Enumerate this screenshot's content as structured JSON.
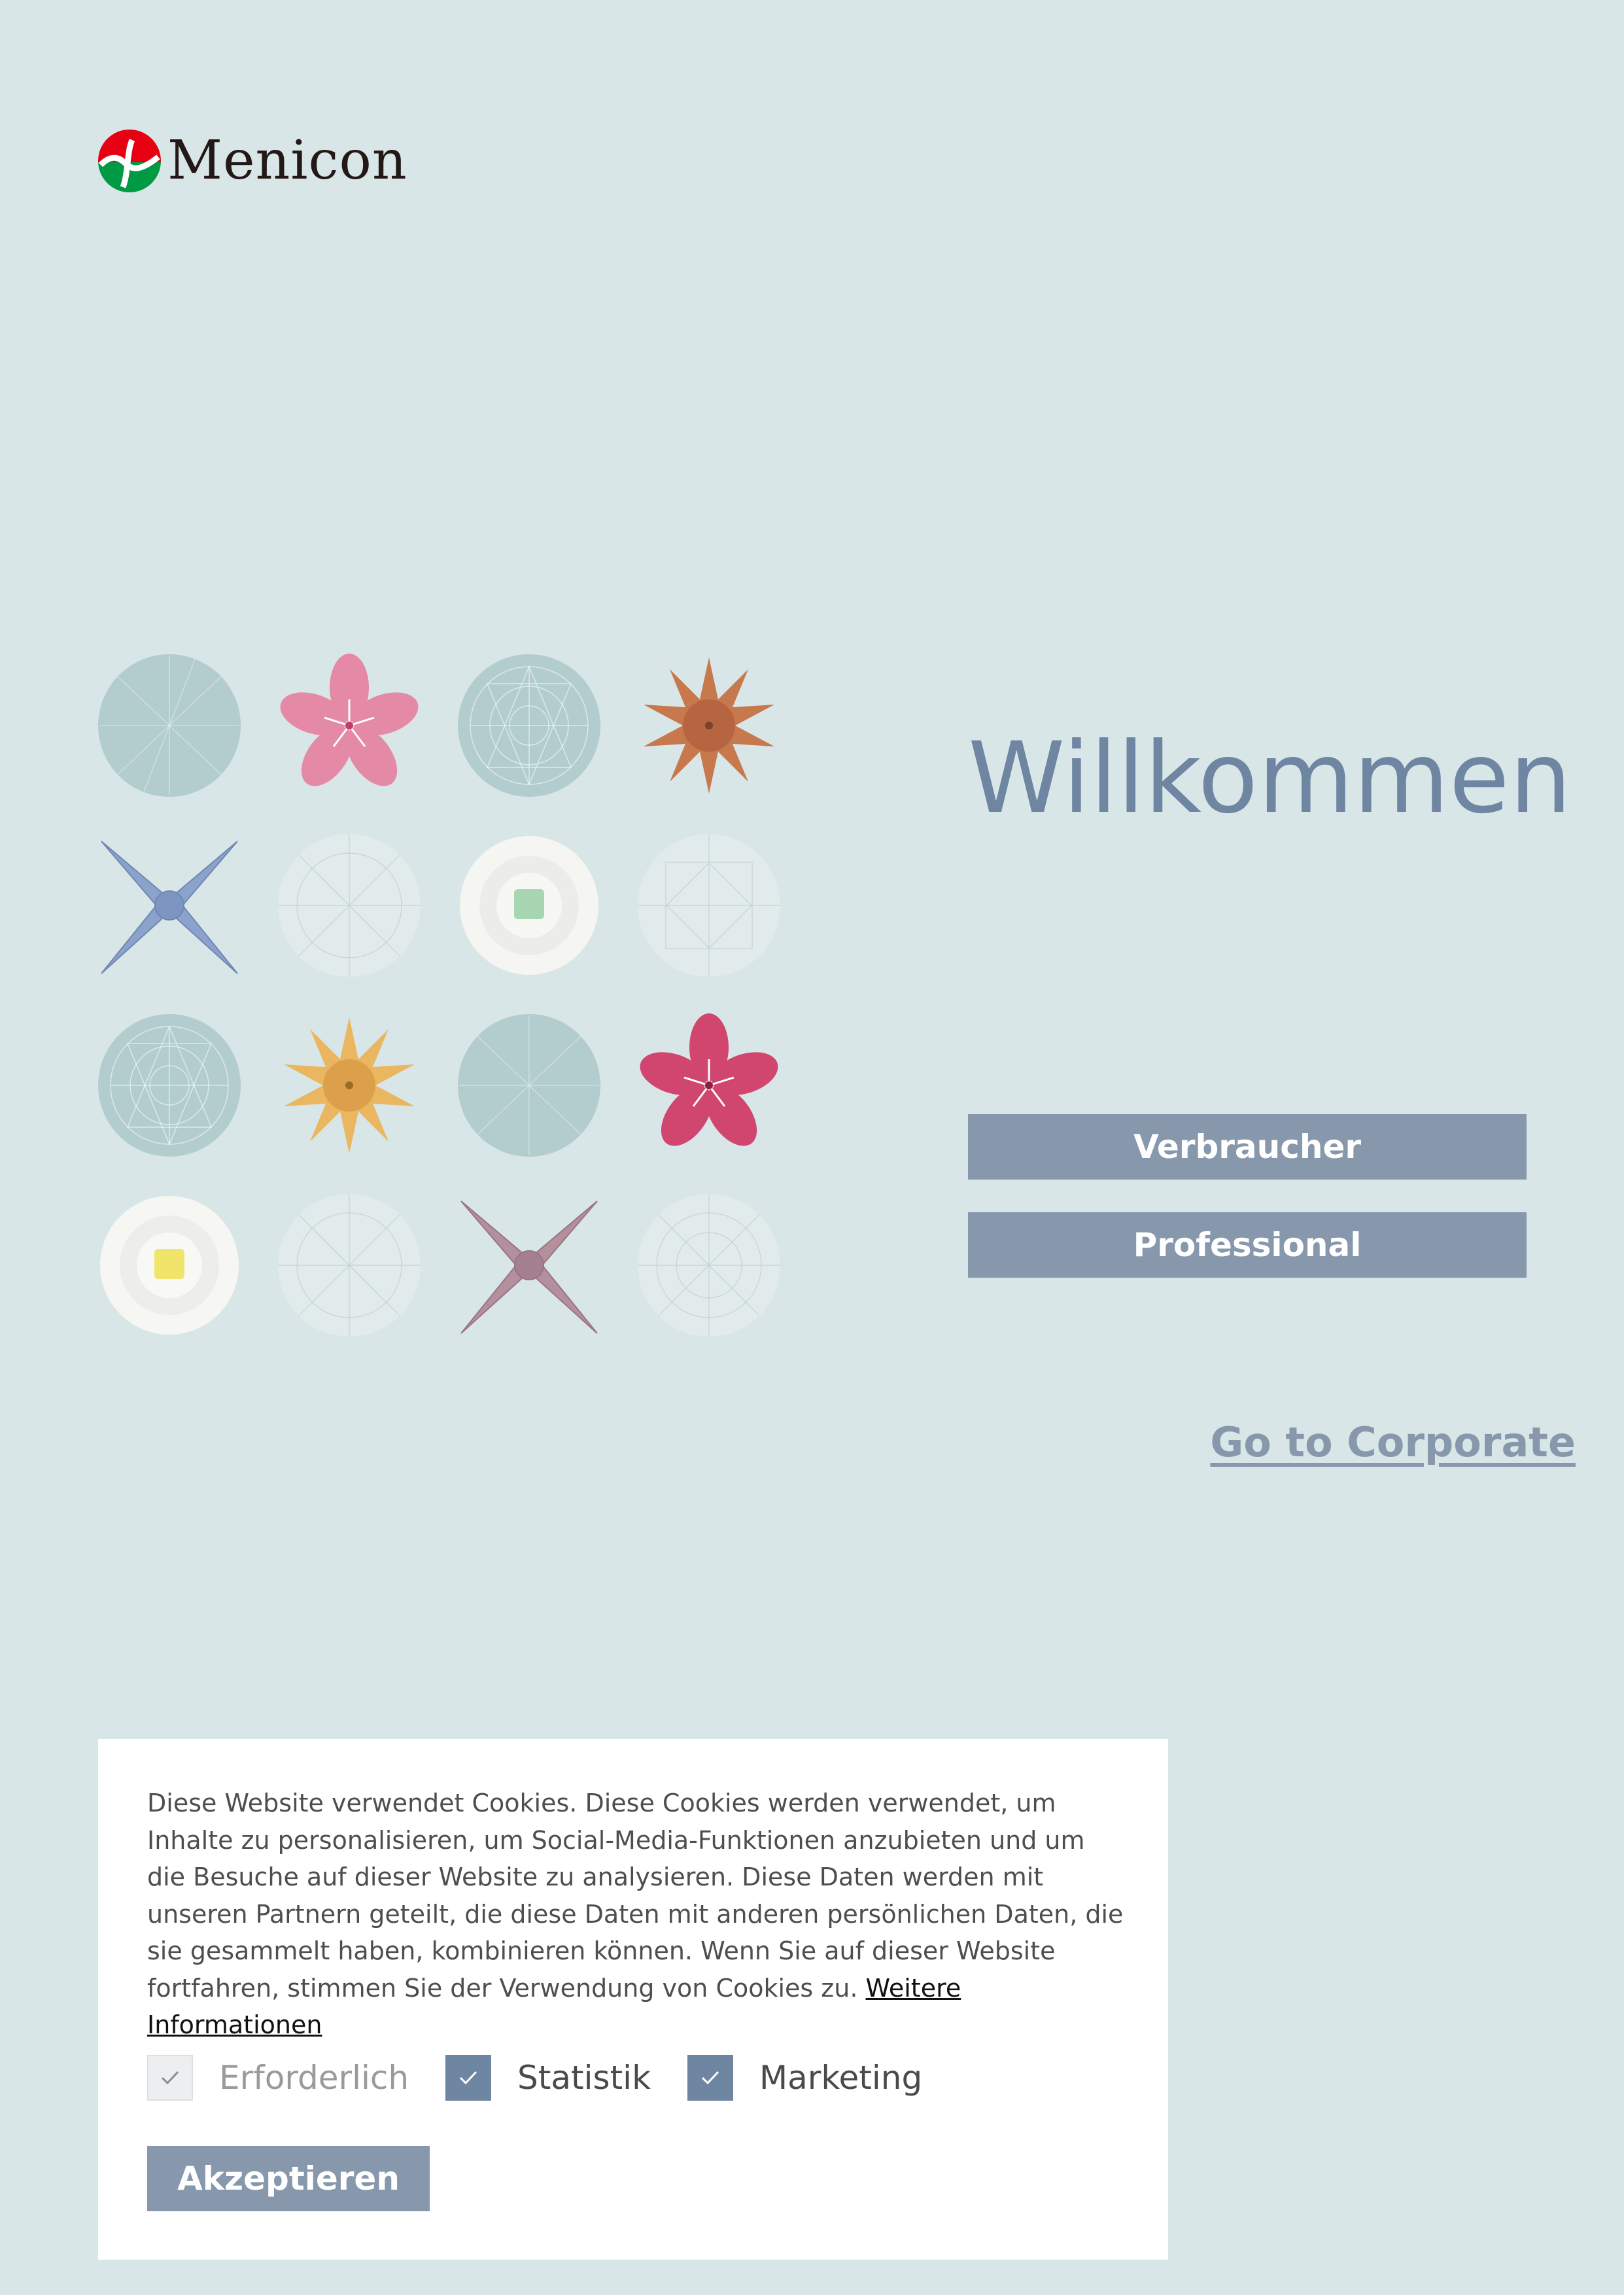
{
  "brand": {
    "name": "Menicon",
    "colors": {
      "red": "#e60012",
      "green": "#009944",
      "dark": "#231815"
    }
  },
  "grid": [
    [
      "teal-disc",
      "pink-origami-flower",
      "pattern-disc",
      "copper-origami-star"
    ],
    [
      "blue-origami-iris",
      "faint-pattern-disc",
      "white-paper-rose-green",
      "faint-pattern-disc"
    ],
    [
      "pattern-disc",
      "gold-origami-star",
      "teal-disc",
      "magenta-origami-flower"
    ],
    [
      "white-paper-rose-yellow",
      "faint-pattern-disc",
      "mauve-origami-iris",
      "faint-pattern-disc"
    ]
  ],
  "main": {
    "title": "Willkommen",
    "consumer_label": "Verbraucher",
    "professional_label": "Professional",
    "corporate_link": "Go to Corporate"
  },
  "cookie": {
    "text": "Diese Website verwendet Cookies. Diese Cookies werden verwendet, um Inhalte zu personalisieren, um Social-Media-Funktionen anzubieten und um die Besuche auf dieser Website zu analysieren. Diese Daten werden mit unseren Partnern geteilt, die diese Daten mit anderen persönlichen Daten, die sie gesammelt haben, kombinieren können. Wenn Sie auf dieser Website fortfahren, stimmen Sie der Verwendung von Cookies zu.",
    "more_info": "Weitere Informationen",
    "options": [
      {
        "label": "Erforderlich",
        "checked": true,
        "disabled": true
      },
      {
        "label": "Statistik",
        "checked": true,
        "disabled": false
      },
      {
        "label": "Marketing",
        "checked": true,
        "disabled": false
      }
    ],
    "accept_label": "Akzeptieren"
  },
  "colors": {
    "background": "#d9e6e7",
    "accent": "#6f86a2",
    "button": "#8798ad",
    "panel": "#ffffff"
  }
}
